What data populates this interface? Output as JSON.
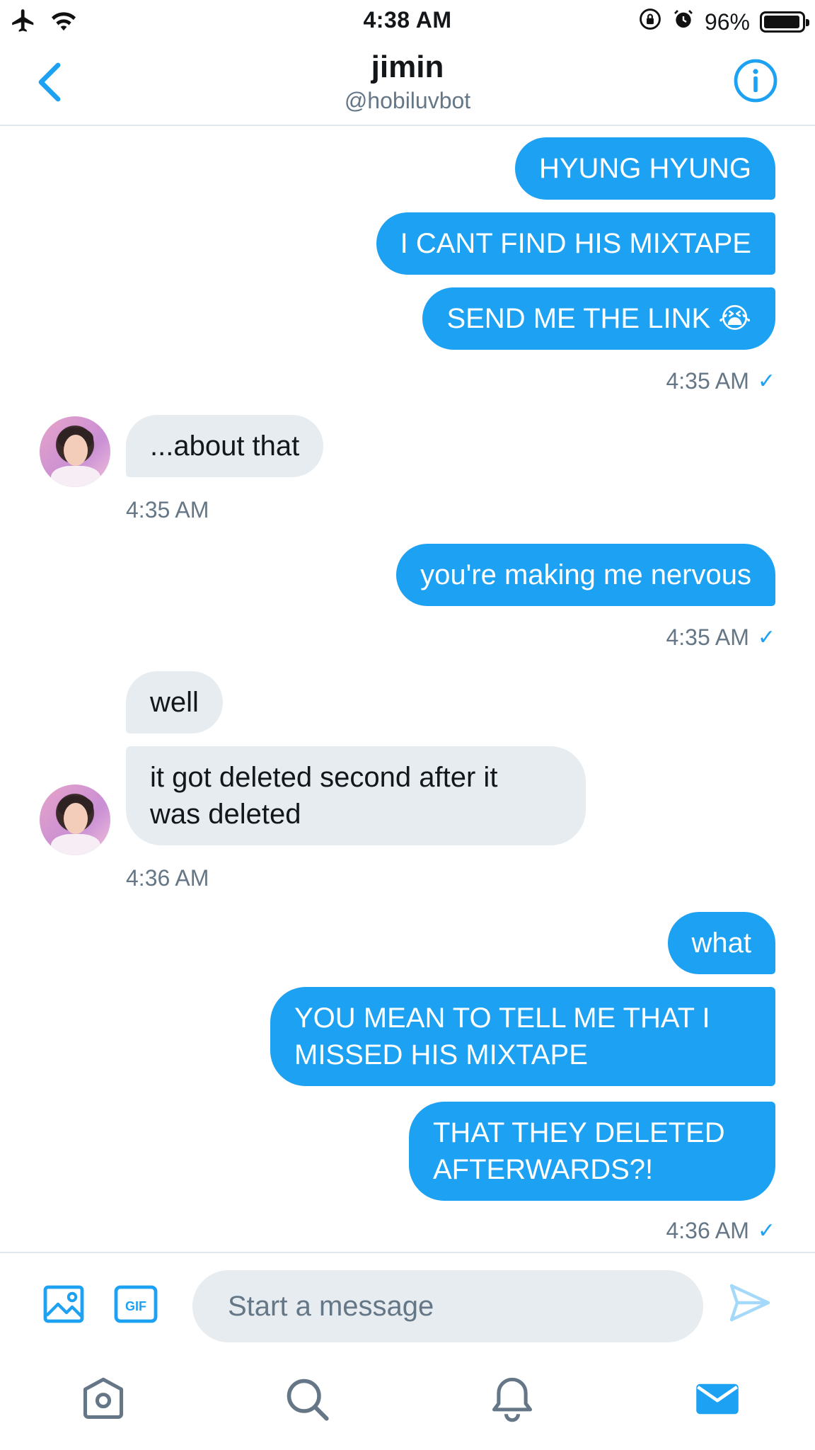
{
  "status_bar": {
    "time": "4:38 AM",
    "battery_text": "96%",
    "battery_level": 0.96,
    "icons": [
      "airplane-icon",
      "wifi-icon",
      "rotation-lock-icon",
      "alarm-icon",
      "battery-icon"
    ]
  },
  "header": {
    "name": "jimin",
    "handle": "@hobiluvbot",
    "icons": [
      "back-chevron-icon",
      "info-icon"
    ]
  },
  "messages": [
    {
      "from": "me",
      "text": "HYUNG HYUNG"
    },
    {
      "from": "me",
      "text": "I CANT FIND HIS MIXTAPE"
    },
    {
      "from": "me",
      "text": "SEND ME THE LINK 😭"
    },
    {
      "from": "me",
      "type": "timestamp",
      "text": "4:35 AM",
      "read": true
    },
    {
      "from": "them",
      "text": "...about that"
    },
    {
      "from": "them",
      "type": "timestamp",
      "text": "4:35 AM"
    },
    {
      "from": "me",
      "text": "you're making me nervous"
    },
    {
      "from": "me",
      "type": "timestamp",
      "text": "4:35 AM",
      "read": true
    },
    {
      "from": "them",
      "text": "well"
    },
    {
      "from": "them",
      "text": "it got deleted second after it\nwas deleted"
    },
    {
      "from": "them",
      "type": "timestamp",
      "text": "4:36 AM"
    },
    {
      "from": "me",
      "text": "what"
    },
    {
      "from": "me",
      "text": "YOU MEAN TO TELL ME THAT I\nMISSED HIS MIXTAPE"
    },
    {
      "from": "me",
      "text": "THAT THEY DELETED\nAFTERWARDS?!"
    },
    {
      "from": "me",
      "type": "timestamp",
      "text": "4:36 AM",
      "read": true
    }
  ],
  "read_check": "✓",
  "composer": {
    "placeholder": "Start a message",
    "gif_label": "GIF",
    "icons": [
      "image-icon",
      "gif-icon",
      "send-icon"
    ]
  },
  "tab_bar": {
    "tabs": [
      "home-icon",
      "search-icon",
      "notifications-icon",
      "messages-icon"
    ],
    "active": "messages-icon"
  },
  "colors": {
    "accent": "#1da1f2",
    "incoming_bubble": "#e6ecf0",
    "secondary_text": "#657786",
    "primary_text": "#14171a"
  }
}
